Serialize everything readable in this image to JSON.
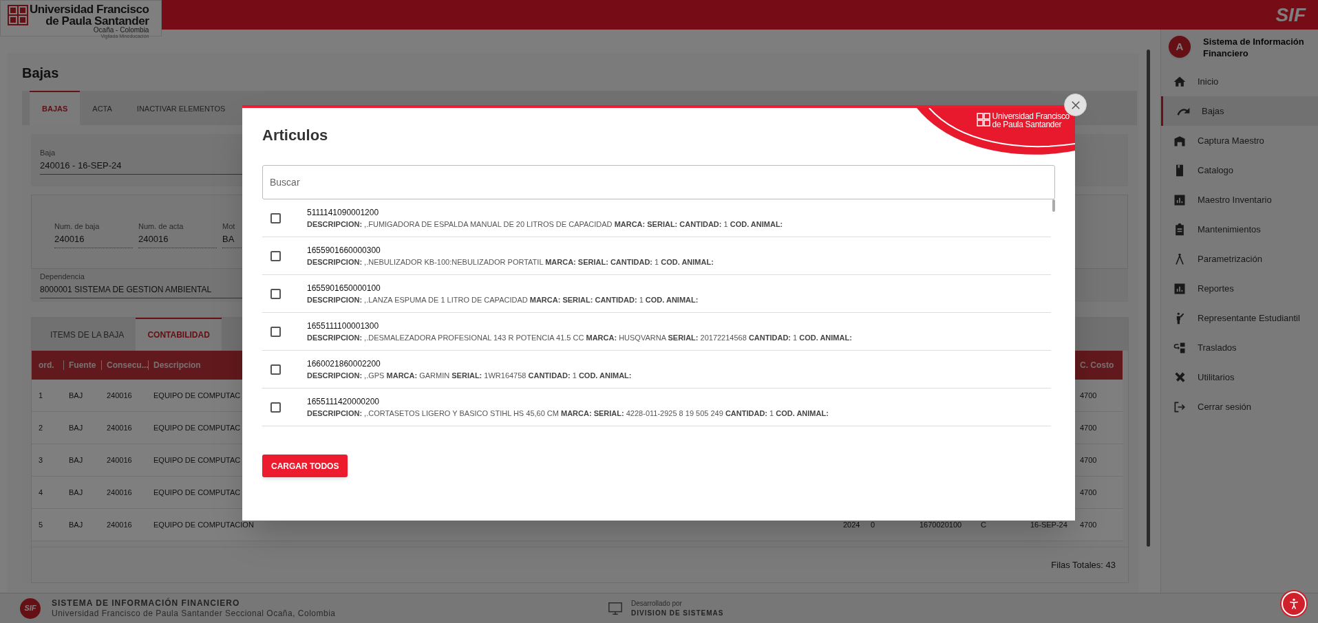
{
  "header": {
    "logo_lines": [
      "Universidad Francisco",
      "de Paula Santander",
      "Ocaña - Colombia",
      "Vigilada Mineducación"
    ],
    "app_name": "SIF"
  },
  "page": {
    "title": "Bajas",
    "tabs": [
      {
        "label": "BAJAS",
        "selected": true
      },
      {
        "label": "ACTA",
        "selected": false
      },
      {
        "label": "INACTIVAR ELEMENTOS",
        "selected": false
      }
    ],
    "baja_field": {
      "label": "Baja",
      "value": "240016 - 16-SEP-24"
    },
    "fields": [
      {
        "label": "Num. de baja",
        "value": "240016"
      },
      {
        "label": "Num. de acta",
        "value": "240016"
      },
      {
        "label": "Mot",
        "value": "BA"
      }
    ],
    "dependencia_field": {
      "label": "Dependencia",
      "value": "8000001 SISTEMA DE GESTION AMBIENTAL"
    },
    "sub_tabs": [
      {
        "label": "ITEMS DE LA BAJA",
        "selected": false
      },
      {
        "label": "CONTABILIDAD",
        "selected": true
      }
    ],
    "table": {
      "columns": [
        "ord.",
        "Fuente",
        "Consecu...",
        "Descripcion",
        null,
        null,
        null,
        null,
        null,
        "C. Costo"
      ],
      "rows": [
        [
          "1",
          "BAJ",
          "240016",
          "EQUIPO DE COMPUTAC",
          null,
          null,
          null,
          null,
          null,
          "4700"
        ],
        [
          "2",
          "BAJ",
          "240016",
          "EQUIPO DE COMPUTAC",
          null,
          null,
          null,
          null,
          null,
          "4700"
        ],
        [
          "3",
          "BAJ",
          "240016",
          "EQUIPO DE COMPUTAC",
          null,
          null,
          null,
          null,
          null,
          "4700"
        ],
        [
          "4",
          "BAJ",
          "240016",
          "EQUIPO DE COMPUTAC",
          null,
          null,
          null,
          null,
          null,
          "4700"
        ],
        [
          "5",
          "BAJ",
          "240016",
          "EQUIPO DE COMPUTACION",
          "2024",
          "0",
          "1670020100",
          "C",
          "16-SEP-24",
          "4700"
        ]
      ],
      "total_rows": "Filas Totales: 43"
    }
  },
  "sidebar": {
    "avatar": "A",
    "title": "Sistema de Información Financiero",
    "items": [
      {
        "label": "Inicio",
        "selected": false
      },
      {
        "label": "Bajas",
        "selected": true
      },
      {
        "label": "Captura Maestro",
        "selected": false
      },
      {
        "label": "Catalogo",
        "selected": false
      },
      {
        "label": "Maestro Inventario",
        "selected": false
      },
      {
        "label": "Mantenimientos",
        "selected": false
      },
      {
        "label": "Parametrización",
        "selected": false
      },
      {
        "label": "Reportes",
        "selected": false
      },
      {
        "label": "Representante Estudiantil",
        "selected": false
      },
      {
        "label": "Traslados",
        "selected": false
      },
      {
        "label": "Utilitarios",
        "selected": false
      },
      {
        "label": "Cerrar sesión",
        "selected": false
      }
    ]
  },
  "footer": {
    "logo_text": "SIF",
    "title": "SISTEMA DE INFORMACIÓN FINANCIERO",
    "subtitle": "Universidad Francisco de Paula Santander Seccional Ocaña, Colombia",
    "credit_label": "Desarrollado por",
    "credit_name": "DIVISION DE SISTEMAS"
  },
  "modal": {
    "title": "Articulos",
    "logo_lines": [
      "Universidad Francisco",
      "de Paula Santander"
    ],
    "search": {
      "placeholder": "Buscar"
    },
    "items": [
      {
        "code": "5111141090001200",
        "description": "**DESCRIPCION:** ,.FUMIGADORA DE ESPALDA MANUAL DE 20 LITROS DE CAPACIDAD **MARCA: SERIAL: CANTIDAD:** 1 **COD. ANIMAL:**",
        "checked": false
      },
      {
        "code": "1655901660000300",
        "description": "**DESCRIPCION:** ,.NEBULIZADOR KB-100:NEBULIZADOR PORTATIL **MARCA: SERIAL: CANTIDAD:** 1 **COD. ANIMAL:**",
        "checked": false
      },
      {
        "code": "1655901650000100",
        "description": "**DESCRIPCION:** ,.LANZA ESPUMA DE 1 LITRO DE CAPACIDAD **MARCA: SERIAL: CANTIDAD:** 1 **COD. ANIMAL:**",
        "checked": false
      },
      {
        "code": "1655111100001300",
        "description": "**DESCRIPCION:** ,.DESMALEZADORA PROFESIONAL 143 R POTENCIA 41.5 CC **MARCA:** HUSQVARNA **SERIAL:** 20172214568 **CANTIDAD:** 1 **COD. ANIMAL:**",
        "checked": false
      },
      {
        "code": "1660021860002200",
        "description": "**DESCRIPCION:** ,.GPS **MARCA:** GARMIN **SERIAL:** 1WR164758 **CANTIDAD:** 1 **COD. ANIMAL:**",
        "checked": false
      },
      {
        "code": "1655111420000200",
        "description": "**DESCRIPCION:** ,.CORTASETOS LIGERO Y BASICO STIHL HS 45,60 CM **MARCA: SERIAL:** 4228-011-2925 8 19 505 249 **CANTIDAD:** 1 **COD. ANIMAL:**",
        "checked": false
      }
    ],
    "button": "CARGAR TODOS"
  }
}
